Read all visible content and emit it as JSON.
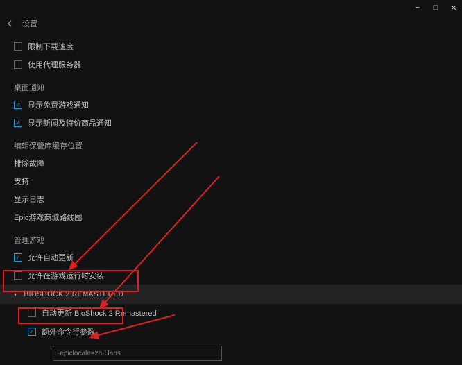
{
  "titlebar": {
    "min": "−",
    "max": "□",
    "close": "✕"
  },
  "header": {
    "title": "设置"
  },
  "downloads": {
    "limit_speed": "限制下载速度",
    "use_proxy": "使用代理服务器"
  },
  "desktop": {
    "title": "桌面通知",
    "show_free_game": "显示免费游戏通知",
    "show_news": "显示新闻及特价商品通知"
  },
  "cache": {
    "title": "编辑保管库缓存位置",
    "troubleshoot": "排除故障",
    "support": "支持",
    "show_log": "显示日志",
    "roadmap": "Epic游戏商城路线图"
  },
  "manage": {
    "title": "管理游戏",
    "auto_update": "允许自动更新",
    "install_in_game": "允许在游戏运行时安装"
  },
  "game": {
    "name": "BIOSHOCK 2 REMASTERED",
    "auto_update_label": "自动更新 BioShock 2 Remastered",
    "extra_args_label": "额外命令行参数",
    "args_value": "-epiclocale=zh-Hans"
  }
}
